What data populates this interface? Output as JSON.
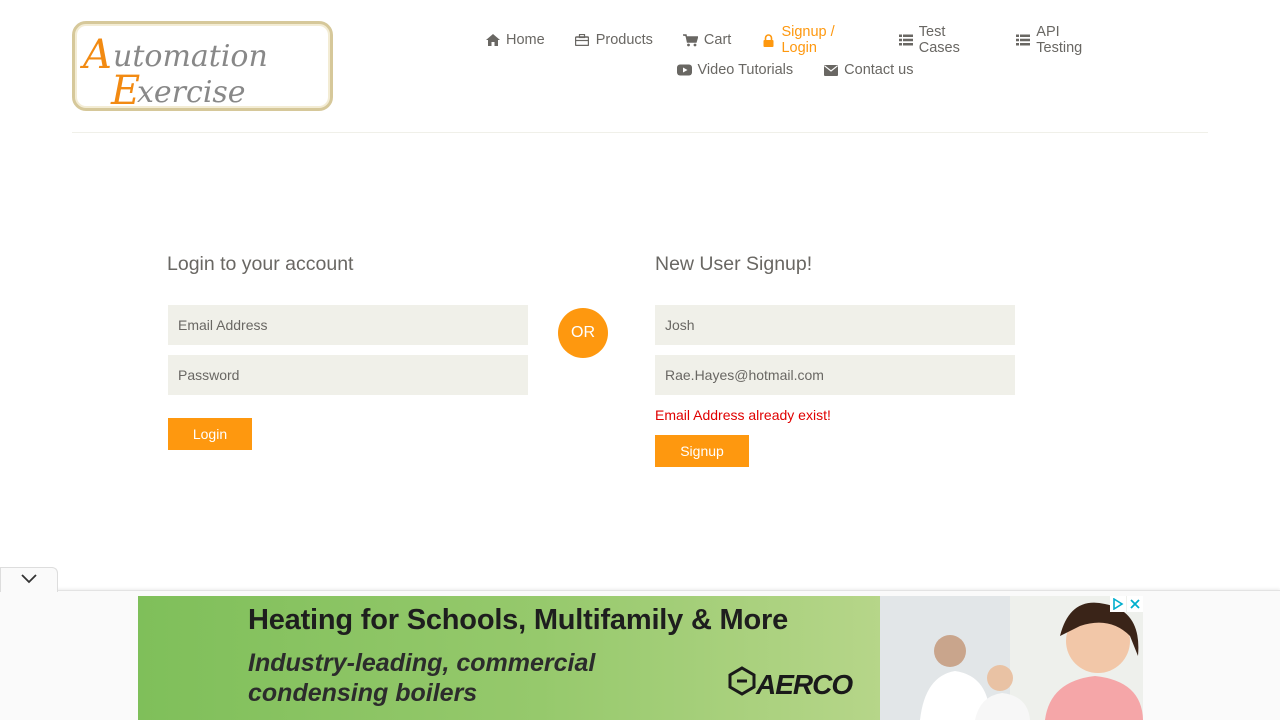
{
  "header": {
    "logo_text": "Automation Exercise",
    "nav": [
      {
        "label": "Home",
        "icon": "home-icon"
      },
      {
        "label": "Products",
        "icon": "briefcase-icon"
      },
      {
        "label": "Cart",
        "icon": "cart-icon"
      },
      {
        "label": "Signup / Login",
        "icon": "lock-icon",
        "active": true
      },
      {
        "label": "Test Cases",
        "icon": "list-icon"
      },
      {
        "label": "API Testing",
        "icon": "list-icon"
      },
      {
        "label": "Video Tutorials",
        "icon": "youtube-play-icon"
      },
      {
        "label": "Contact us",
        "icon": "envelope-icon"
      }
    ]
  },
  "login": {
    "title": "Login to your account",
    "email_placeholder": "Email Address",
    "password_placeholder": "Password",
    "button": "Login"
  },
  "or_label": "OR",
  "signup": {
    "title": "New User Signup!",
    "name_value": "Josh",
    "email_value": "Rae.Hayes@hotmail.com",
    "error": "Email Address already exist!",
    "button": "Signup"
  },
  "ad": {
    "headline": "Heating for Schools, Multifamily & More",
    "subline_1": "Industry-leading, commercial",
    "subline_2": "condensing boilers",
    "brand": "AERCO"
  },
  "colors": {
    "accent": "#fe980f",
    "text": "#696763",
    "field_bg": "#f0f0e9",
    "error": "#e00000"
  }
}
